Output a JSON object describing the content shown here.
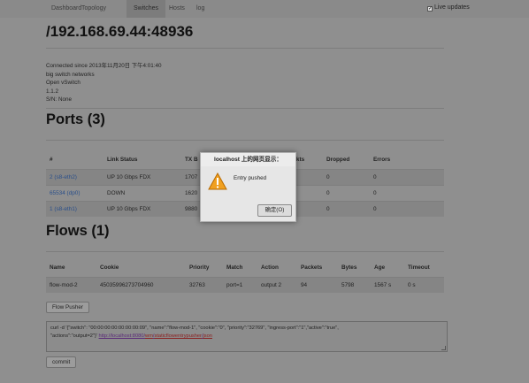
{
  "nav": {
    "items": [
      {
        "label": "Dashboard"
      },
      {
        "label": "Topology"
      },
      {
        "label": "Switches",
        "active": true
      },
      {
        "label": "Hosts"
      },
      {
        "label": "log"
      }
    ],
    "live_updates_label": "Live updates",
    "live_updates_checked": true
  },
  "switch": {
    "title": "/192.168.69.44:48936",
    "info": [
      "Connected since 2013年11月20日 下午4:01:40",
      "big switch networks",
      "Open vSwitch",
      "1.1.2",
      "S/N: None"
    ]
  },
  "ports": {
    "heading": "Ports (3)",
    "columns": [
      "#",
      "Link Status",
      "TX B",
      "ts",
      "RX Pkts",
      "Dropped",
      "Errors"
    ],
    "rows": [
      [
        "2 (s8-eth2)",
        "UP 10 Gbps FDX",
        "1707",
        "",
        "146",
        "0",
        "0"
      ],
      [
        "65534 (dp0)",
        "DOWN",
        "1620",
        "",
        "0",
        "0",
        "0"
      ],
      [
        "1 (s8-eth1)",
        "UP 10 Gbps FDX",
        "9880",
        "",
        "157",
        "0",
        "0"
      ]
    ]
  },
  "flows": {
    "heading": "Flows (1)",
    "columns": [
      "Name",
      "Cookie",
      "Priority",
      "Match",
      "Action",
      "Packets",
      "Bytes",
      "Age",
      "Timeout"
    ],
    "rows": [
      [
        "flow-mod-2",
        "45035996273704960",
        "32763",
        "port=1",
        "output 2",
        "94",
        "5798",
        "1567 s",
        "0 s"
      ]
    ]
  },
  "flow_pusher_label": "Flow Pusher",
  "curl": {
    "line1": "curl -d '{\"switch\": \"00:00:00:00:00:00:00:09\", \"name\":\"flow-mod-1\", \"cookie\":\"0\", \"priority\":\"32769\", \"ingress-port\":\"1\",\"active\":\"true\",",
    "line2_prefix": "\"actions\":\"output=2\"}' ",
    "url_part1": "http://localhost:8080/",
    "url_part2": "wm",
    "url_part3": "/",
    "url_part4": "staticflowentrypusher",
    "url_part5": "/",
    "url_part6": "json"
  },
  "commit_label": "commit",
  "dialog": {
    "title": "localhost 上的网页显示：",
    "message": "Entry pushed",
    "ok_label": "确定(O)"
  }
}
